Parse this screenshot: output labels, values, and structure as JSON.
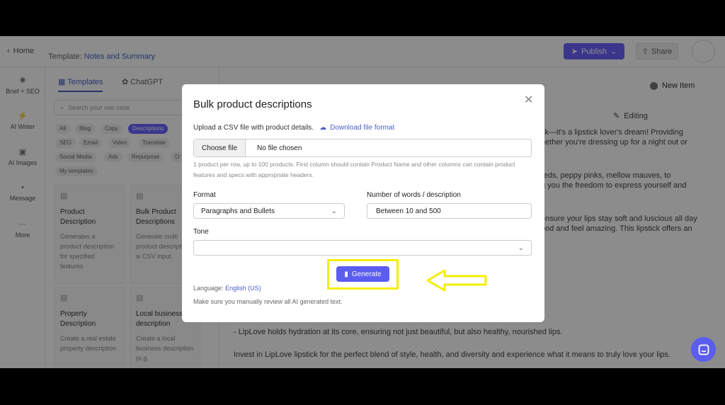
{
  "topbar": {
    "home_label": "Home",
    "template_prefix": "Template:",
    "template_name": "Notes and Summary",
    "publish_label": "Publish",
    "share_label": "Share"
  },
  "leftnav": {
    "items": [
      {
        "label": "Brief + SEO",
        "icon": "brief-icon"
      },
      {
        "label": "AI Writer",
        "icon": "bolt-icon"
      },
      {
        "label": "AI Images",
        "icon": "image-icon"
      },
      {
        "label": "Message",
        "icon": "message-icon"
      },
      {
        "label": "More",
        "icon": "more-icon"
      }
    ]
  },
  "panel": {
    "tabs": [
      "Templates",
      "ChatGPT"
    ],
    "search_placeholder": "Search your use case",
    "chips": [
      "All",
      "Blog",
      "Copy",
      "Descriptions",
      "SEO",
      "Email",
      "Video",
      "Translate",
      "Social Media",
      "Ads",
      "Repurpose",
      "O",
      "My templates"
    ],
    "cards": [
      {
        "title": "Product Description",
        "desc": "Generates a product description for specified features"
      },
      {
        "title": "Bulk Product Descriptions",
        "desc": "Generate multi product descriptions w CSV input."
      },
      {
        "title": "Property Description",
        "desc": "Create a real estate property description"
      },
      {
        "title": "Local business description",
        "desc": "Create a local business description (e.g."
      }
    ]
  },
  "editor": {
    "new_item_label": "New Item",
    "editing_label": "Editing",
    "lines": [
      "ck—it's a lipstick lover's dream! Providing",
      "hether you're dressing up for a night out or",
      "reds, peppy pinks, mellow mauves, to",
      "g you the freedom to express yourself and",
      "ensure your lips stay soft and luscious all day",
      "ood and feel amazing. This lipstick offers an",
      "- LipLove holds hydration at its core, ensuring not just beautiful, but also healthy, nourished lips.",
      "Invest in LipLove lipstick for the perfect blend of style, health, and diversity and experience what it means to truly love your lips."
    ]
  },
  "modal": {
    "title": "Bulk product descriptions",
    "upload_label": "Upload a CSV file with product details.",
    "download_label": "Download file format",
    "choose_file_label": "Choose file",
    "file_status": "No file chosen",
    "help_text": "1 product per row, up to 100 products. First column should contain Product Name and other columns can contain product features and specs with appropriate headers.",
    "format_label": "Format",
    "format_value": "Paragraphs and Bullets",
    "words_label": "Number of words / description",
    "words_value": "Between 10 and 500",
    "tone_label": "Tone",
    "tone_value": "",
    "generate_label": "Generate",
    "language_prefix": "Language:",
    "language_value": "English (US)",
    "review_note": "Make sure you manually review all AI generated text."
  },
  "colors": {
    "accent": "#5b5cf0",
    "highlight": "#f5ee00"
  }
}
